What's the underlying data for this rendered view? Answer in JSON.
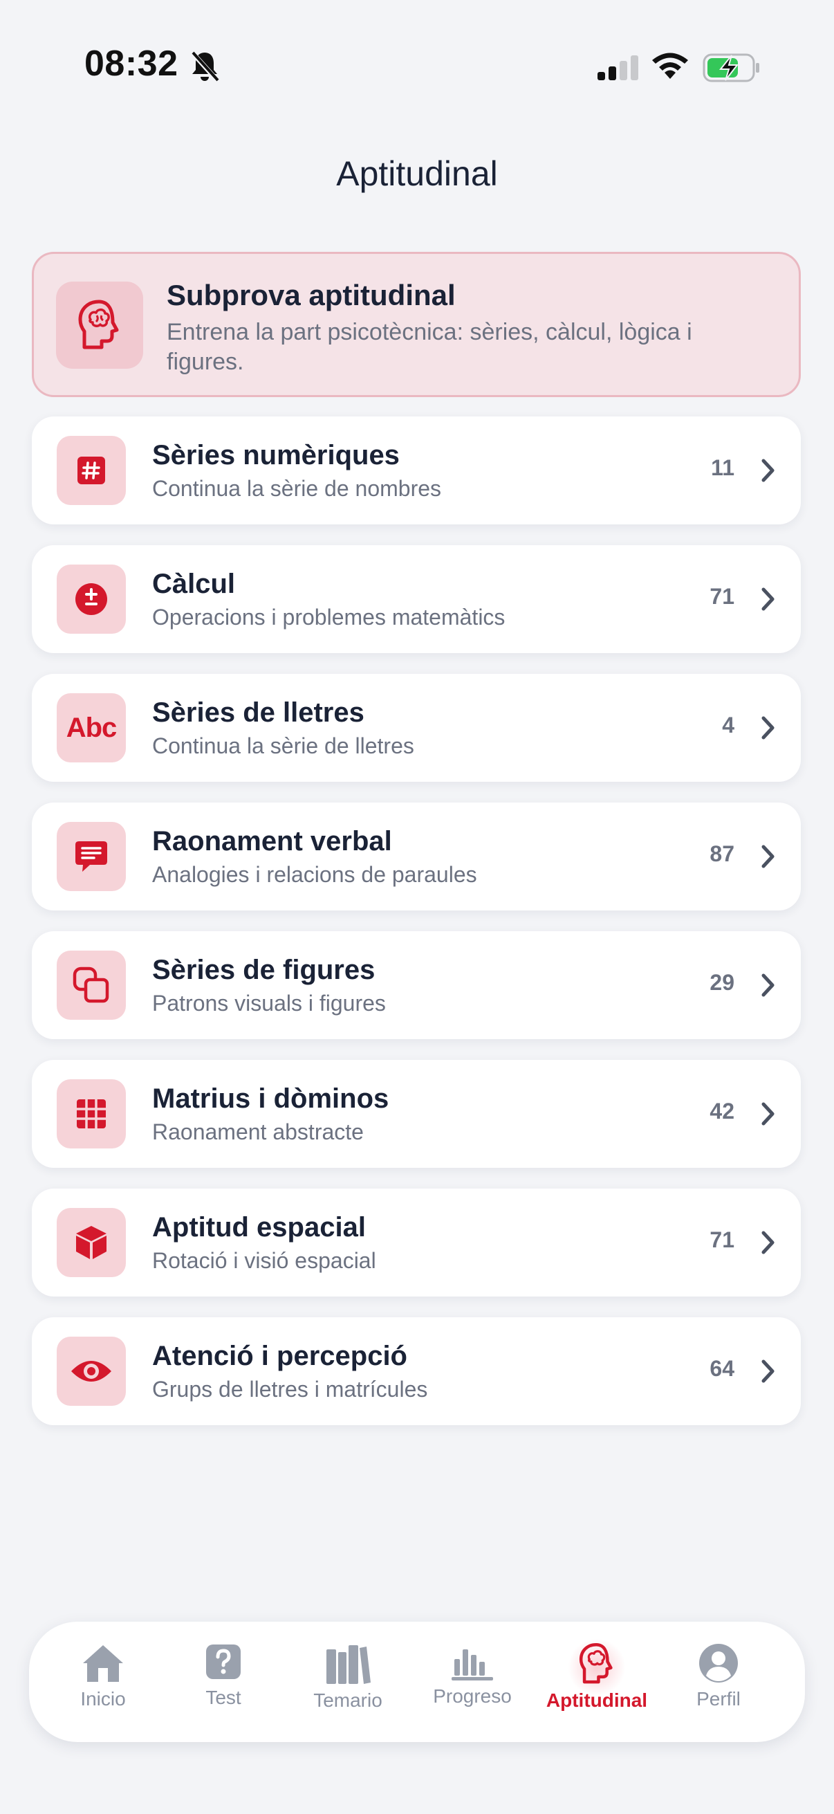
{
  "status_bar": {
    "time": "08:32",
    "icons": [
      "bell-slash-icon",
      "cellular-signal-icon",
      "wifi-icon",
      "battery-charging-icon"
    ]
  },
  "header": {
    "title": "Aptitudinal"
  },
  "hero": {
    "icon": "brain-head-icon",
    "title": "Subprova aptitudinal",
    "description": "Entrena la part psicotècnica: sèries, càlcul, lògica i figures."
  },
  "categories": [
    {
      "icon": "hash-icon",
      "title": "Sèries numèriques",
      "subtitle": "Continua la sèrie de nombres",
      "count": "11"
    },
    {
      "icon": "plus-minus-icon",
      "title": "Càlcul",
      "subtitle": "Operacions i problemes matemàtics",
      "count": "71"
    },
    {
      "icon": "abc-icon",
      "icon_text": "Abc",
      "title": "Sèries de lletres",
      "subtitle": "Continua la sèrie de lletres",
      "count": "4"
    },
    {
      "icon": "text-bubble-icon",
      "title": "Raonament verbal",
      "subtitle": "Analogies i relacions de paraules",
      "count": "87"
    },
    {
      "icon": "overlapping-squares-icon",
      "title": "Sèries de figures",
      "subtitle": "Patrons visuals i figures",
      "count": "29"
    },
    {
      "icon": "grid-icon",
      "title": "Matrius i dòminos",
      "subtitle": "Raonament abstracte",
      "count": "42"
    },
    {
      "icon": "cube-icon",
      "title": "Aptitud espacial",
      "subtitle": "Rotació i visió espacial",
      "count": "71"
    },
    {
      "icon": "eye-icon",
      "title": "Atenció i percepció",
      "subtitle": "Grups de lletres i matrícules",
      "count": "64"
    }
  ],
  "tabbar": {
    "tabs": [
      {
        "label": "Inicio",
        "icon": "house-icon",
        "active": false
      },
      {
        "label": "Test",
        "icon": "question-square-icon",
        "active": false
      },
      {
        "label": "Temario",
        "icon": "books-icon",
        "active": false
      },
      {
        "label": "Progreso",
        "icon": "bar-chart-icon",
        "active": false
      },
      {
        "label": "Aptitudinal",
        "icon": "brain-head-icon",
        "active": true
      },
      {
        "label": "Perfil",
        "icon": "person-circle-icon",
        "active": false
      }
    ]
  },
  "colors": {
    "accent": "#d4182c",
    "accent_soft": "#f6d3d8",
    "hero_bg": "#f5e3e7",
    "hero_border": "#eab8c1",
    "text_primary": "#1a2236",
    "text_secondary": "#6b7180",
    "tab_inactive": "#8a91a0",
    "background": "#f3f4f7"
  }
}
